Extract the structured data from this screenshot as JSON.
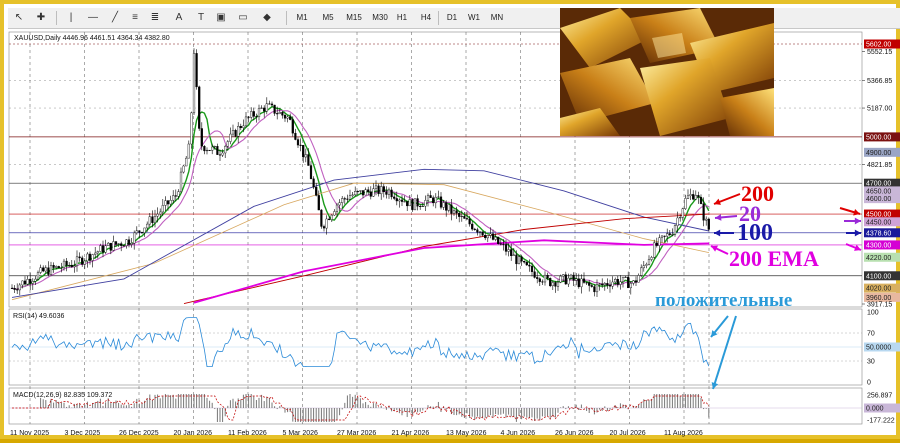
{
  "toolbar": {
    "timeframes": [
      "M1",
      "M5",
      "M15",
      "M30",
      "H1",
      "H4",
      "D1",
      "W1",
      "MN"
    ]
  },
  "chart_header": "XAUUSD,Daily  4446.96 4461.51 4364.34 4382.80",
  "price_axis": {
    "labels": [
      "5602.00",
      "5552.15",
      "5366.85",
      "5187.00",
      "5000.00",
      "4900.00",
      "4821.85",
      "4700.00",
      "4650.00",
      "4600.00",
      "4500.00",
      "4450.00",
      "4378.60",
      "4300.00",
      "4220.00",
      "4100.00",
      "4020.00",
      "3960.00",
      "3917.15"
    ],
    "highlight": {
      "5602.00": "#c00000",
      "5000.00": "#7b1010",
      "4900.00": "#9aa5c5",
      "4700.00": "#333333",
      "4650.00": "#c9b7d8",
      "4600.00": "#c9b7d8",
      "4500.00": "#c00000",
      "4450.00": "#cfa3d6",
      "4378.60": "#1a1a9a",
      "4300.00": "#d400d4",
      "4220.00": "#b8e0b0",
      "4100.00": "#333333",
      "4020.00": "#d8b060",
      "3960.00": "#e8b8a0"
    }
  },
  "date_axis": [
    "11 Nov 2025",
    "3 Dec 2025",
    "26 Dec 2025",
    "20 Jan 2026",
    "11 Feb 2026",
    "5 Mar 2026",
    "27 Mar 2026",
    "21 Apr 2026",
    "13 May 2026",
    "4 Jun 2026",
    "26 Jun 2026",
    "20 Jul 2026",
    "11 Aug 2026"
  ],
  "annotations": {
    "ma200": "200",
    "ma20": "20",
    "ma100": "100",
    "ema200": "200 EMA",
    "positive": "положительные"
  },
  "rsi": {
    "label": "RSI(14) 49.6036",
    "levels": [
      "100",
      "70",
      "30",
      "0"
    ],
    "value_box": "50.0000"
  },
  "macd": {
    "label": "MACD(12,26,9) 82.835 109.372",
    "levels": [
      "256.897",
      "0.000",
      "-177.222"
    ]
  },
  "colors": {
    "frame": "#e6c12a",
    "ma20": "#1a9a1a",
    "ma50": "#c060c0",
    "ma100": "#4040a0",
    "ma200": "#c00000",
    "ema200": "#e000e0",
    "annotation_red": "#e00000",
    "annotation_purple": "#9a2ad8",
    "annotation_blue": "#1a1aa8",
    "annotation_magenta": "#e000e0",
    "annotation_cyan": "#2a9ad8"
  },
  "icons": [
    "cursor-icon",
    "crosshair-icon",
    "line-icon",
    "trendline-icon",
    "channel-icon",
    "text-icon",
    "label-icon",
    "fit-icon",
    "shapes-icon",
    "period-icon"
  ]
}
